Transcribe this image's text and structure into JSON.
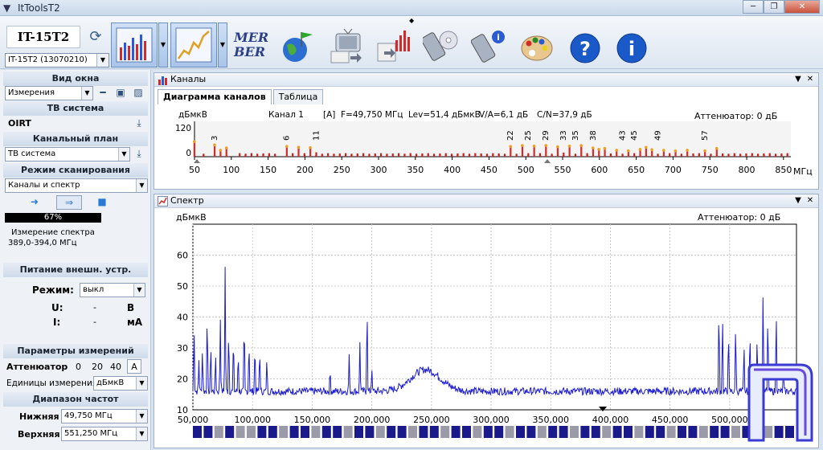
{
  "window": {
    "title": "ItToolsT2"
  },
  "toolbar": {
    "device_name": "IT-15T2",
    "device_selector": "IT-15T2 (13070210)",
    "mer": "MER",
    "ber": "BER"
  },
  "left": {
    "view_title": "Вид окна",
    "view_value": "Измерения",
    "tv_system_title": "ТВ система",
    "tv_system_value": "OIRT",
    "channel_plan_title": "Канальный план",
    "channel_plan_value": "ТВ система",
    "scan_mode_title": "Режим сканирования",
    "scan_mode_value": "Каналы и спектр",
    "progress_text": "67%",
    "progress_value": 67,
    "status_line1": "Измерение спектра",
    "status_line2": "389,0-394,0 МГц",
    "ext_power_title": "Питание внешн. устр.",
    "mode_label": "Режим:",
    "mode_value": "выкл",
    "u_label": "U:",
    "u_value": "-",
    "u_unit": "В",
    "i_label": "I:",
    "i_value": "-",
    "i_unit": "мА",
    "meas_params_title": "Параметры измерений",
    "attenuator_label": "Аттенюатор",
    "att_opt1": "0",
    "att_opt2": "20",
    "att_opt3": "40",
    "att_auto": "A",
    "units_label": "Единицы измерения",
    "units_value": "дБмкВ",
    "freq_range_title": "Диапазон частот",
    "lower_label": "Нижняя",
    "lower_value": "49,750 МГц",
    "upper_label": "Верхняя",
    "upper_value": "551,250 МГц"
  },
  "channels_panel": {
    "title": "Каналы",
    "tabs": [
      "Диаграмма каналов",
      "Таблица"
    ],
    "unit": "дБмкВ",
    "channel": "Канал 1",
    "mode": "[A]",
    "freq": "F=49,750 МГц",
    "lev": "Lev=51,4 дБмкВ",
    "va": "V/A=6,1 дБ",
    "cn": "C/N=37,9 дБ",
    "attenuator": "Аттенюатор: 0 дБ",
    "x_unit": "МГц",
    "y_ticks": [
      "120",
      "0"
    ],
    "x_ticks": [
      "50",
      "100",
      "150",
      "200",
      "250",
      "300",
      "350",
      "400",
      "450",
      "500",
      "550",
      "600",
      "650",
      "700",
      "750",
      "800",
      "850"
    ],
    "channel_labels": [
      "3",
      "6",
      "11",
      "22",
      "25",
      "29",
      "33",
      "35",
      "38",
      "43",
      "45",
      "49",
      "57"
    ]
  },
  "spectrum_panel": {
    "title": "Спектр",
    "unit": "дБмкВ",
    "attenuator": "Аттенюатор: 0 дБ",
    "x_unit_partial": "М"
  },
  "chart_data": [
    {
      "type": "bar",
      "title": "",
      "ylabel": "дБмкВ",
      "xlabel": "МГц",
      "xlim": [
        50,
        860
      ],
      "ylim": [
        0,
        120
      ],
      "x_ticks": [
        50,
        100,
        150,
        200,
        250,
        300,
        350,
        400,
        450,
        500,
        550,
        600,
        650,
        700,
        750,
        800,
        850
      ],
      "series": [
        {
          "x": [
            49.75,
            62.25,
            77.25,
            85.25,
            93.25,
            111.25,
            119.25,
            127.25,
            135.25,
            143.25,
            151.25,
            159.25,
            175.25,
            183.25,
            191.25,
            199.25,
            207.25,
            215.25,
            223.25,
            231.25,
            239.25,
            247.25,
            255.25,
            263.25,
            271.25,
            279.25,
            287.25,
            295.25,
            303.25,
            311.25,
            319.25,
            327.25,
            335.25,
            343.25,
            351.25,
            359.25,
            367.25,
            375.25,
            383.25,
            391.25,
            399.25,
            407.25,
            415.25,
            423.25,
            431.25,
            439.25,
            447.25,
            455.25,
            463.25,
            471.25,
            479.25,
            487.25,
            495.25,
            503.25,
            511.25,
            519.25,
            527.25,
            535.25,
            543.25,
            551.25,
            559.25,
            567.25,
            575.25,
            583.25,
            591.25,
            599.25,
            607.25,
            615.25,
            623.25,
            631.25,
            639.25,
            647.25,
            655.25,
            663.25,
            671.25,
            679.25,
            687.25,
            695.25,
            703.25,
            711.25,
            719.25,
            727.25,
            735.25,
            743.25,
            751.25,
            759.25,
            767.25,
            775.25,
            783.25,
            791.25,
            799.25,
            807.25,
            815.25,
            823.25,
            831.25,
            839.25,
            847.25,
            855.25
          ],
          "values": [
            51,
            10,
            40,
            22,
            30,
            12,
            10,
            12,
            10,
            11,
            12,
            10,
            35,
            12,
            32,
            12,
            31,
            15,
            10,
            12,
            10,
            11,
            12,
            10,
            11,
            12,
            10,
            11,
            12,
            10,
            11,
            12,
            10,
            12,
            10,
            11,
            12,
            10,
            11,
            12,
            10,
            11,
            12,
            10,
            12,
            11,
            10,
            12,
            11,
            10,
            35,
            10,
            38,
            12,
            36,
            12,
            38,
            10,
            34,
            14,
            36,
            10,
            38,
            12,
            30,
            25,
            28,
            11,
            22,
            10,
            20,
            12,
            25,
            32,
            24,
            10,
            22,
            12,
            20,
            10,
            22,
            11,
            12,
            20,
            10,
            28,
            11,
            10,
            12,
            10,
            11,
            12,
            10,
            11,
            12,
            10,
            11,
            12
          ]
        }
      ]
    },
    {
      "type": "line",
      "title": "",
      "ylabel": "дБмкВ",
      "xlabel": "",
      "xlim": [
        50000,
        556000
      ],
      "ylim": [
        10,
        70
      ],
      "x_ticks": [
        50000,
        100000,
        150000,
        200000,
        250000,
        300000,
        350000,
        400000,
        450000,
        500000
      ],
      "x_tick_labels": [
        "50,000",
        "100,000",
        "150,000",
        "200,000",
        "250,000",
        "300,000",
        "350,000",
        "400,000",
        "450,000",
        "500,000"
      ],
      "y_ticks": [
        10,
        20,
        30,
        40,
        50,
        60
      ],
      "noise_floor": 16,
      "bump": {
        "center": 245000,
        "width": 35000,
        "height": 7
      },
      "peaks": [
        {
          "x": 51000,
          "y": 38
        },
        {
          "x": 55000,
          "y": 27
        },
        {
          "x": 58000,
          "y": 31
        },
        {
          "x": 62000,
          "y": 44
        },
        {
          "x": 65000,
          "y": 33
        },
        {
          "x": 69000,
          "y": 29
        },
        {
          "x": 73000,
          "y": 41
        },
        {
          "x": 77000,
          "y": 57
        },
        {
          "x": 80000,
          "y": 38
        },
        {
          "x": 84000,
          "y": 36
        },
        {
          "x": 88000,
          "y": 30
        },
        {
          "x": 93000,
          "y": 42
        },
        {
          "x": 97000,
          "y": 34
        },
        {
          "x": 102000,
          "y": 33
        },
        {
          "x": 106000,
          "y": 31
        },
        {
          "x": 112000,
          "y": 28
        },
        {
          "x": 165000,
          "y": 24
        },
        {
          "x": 181000,
          "y": 28
        },
        {
          "x": 190000,
          "y": 32
        },
        {
          "x": 196000,
          "y": 46
        },
        {
          "x": 200000,
          "y": 24
        },
        {
          "x": 491000,
          "y": 47
        },
        {
          "x": 494000,
          "y": 44
        },
        {
          "x": 499000,
          "y": 38
        },
        {
          "x": 505000,
          "y": 40
        },
        {
          "x": 512000,
          "y": 33
        },
        {
          "x": 517000,
          "y": 38
        },
        {
          "x": 523000,
          "y": 36
        },
        {
          "x": 528000,
          "y": 52
        },
        {
          "x": 532000,
          "y": 43
        },
        {
          "x": 539000,
          "y": 44
        },
        {
          "x": 545000,
          "y": 24
        }
      ]
    }
  ]
}
